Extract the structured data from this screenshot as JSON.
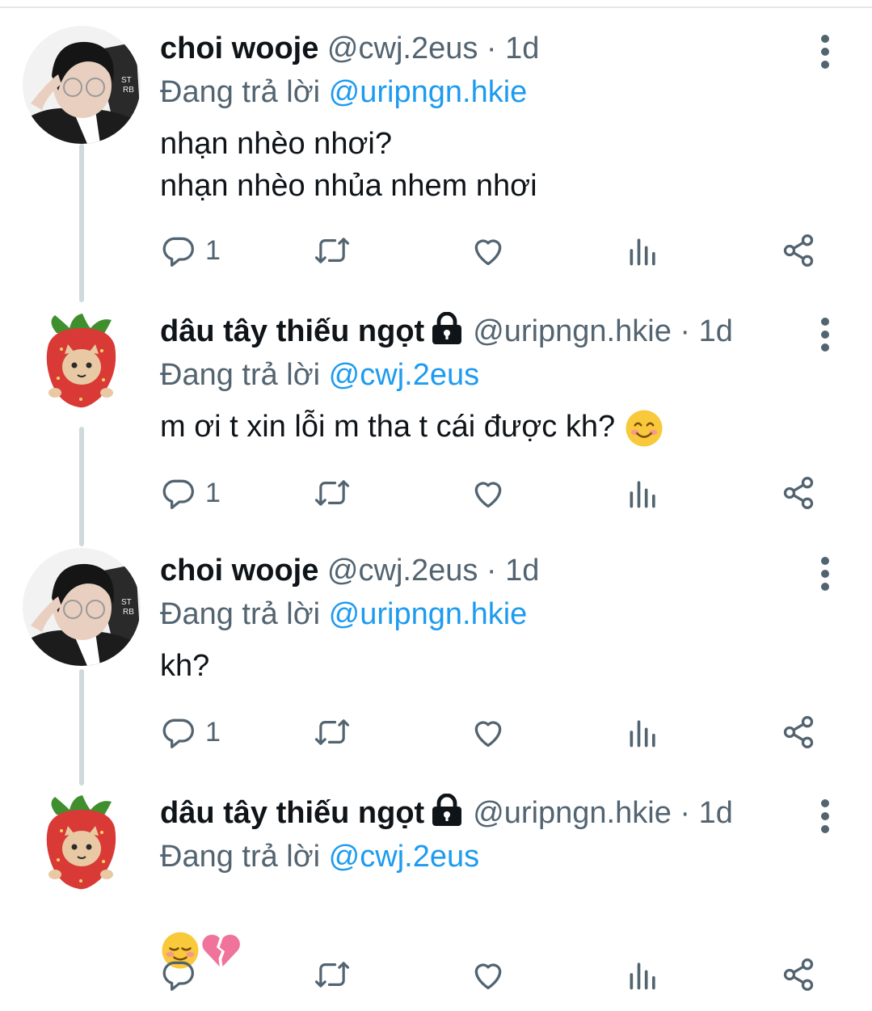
{
  "tweets": [
    {
      "author": "choi wooje",
      "handle": "@cwj.2eus",
      "time": "· 1d",
      "replying_prefix": "Đang trả lời ",
      "replying_to": "@uripngn.hkie",
      "text_lines": [
        "nhạn nhèo nhơi?",
        "nhạn nhèo nhủa nhem nhơi"
      ],
      "reply_count": "1",
      "avatar_icon": "person-avatar",
      "locked": false
    },
    {
      "author": "dâu tây thiếu ngọt",
      "handle": "@uripngn.hkie",
      "time": "· 1d",
      "replying_prefix": "Đang trả lời ",
      "replying_to": "@cwj.2eus",
      "text": "m ơi t xin lỗi m tha t cái được kh?",
      "emoji": "smiling-face-emoji",
      "reply_count": "1",
      "avatar_icon": "strawberry-cat-avatar",
      "locked": true
    },
    {
      "author": "choi wooje",
      "handle": "@cwj.2eus",
      "time": "· 1d",
      "replying_prefix": "Đang trả lời ",
      "replying_to": "@uripngn.hkie",
      "text": "kh?",
      "reply_count": "1",
      "avatar_icon": "person-avatar",
      "locked": false
    },
    {
      "author": "dâu tây thiếu ngọt",
      "handle": "@uripngn.hkie",
      "time": "· 1d",
      "replying_prefix": "Đang trả lời ",
      "replying_to": "@cwj.2eus",
      "emojis": [
        "relieved-face-emoji",
        "broken-heart-emoji"
      ],
      "reply_count": "",
      "avatar_icon": "strawberry-cat-avatar",
      "locked": true
    }
  ],
  "action_icons": [
    "reply-icon",
    "retweet-icon",
    "like-icon",
    "views-icon",
    "share-icon"
  ],
  "colors": {
    "text": "#0f1419",
    "secondary": "#536471",
    "link": "#1d9bf0",
    "thread_line": "#cfd9de"
  }
}
